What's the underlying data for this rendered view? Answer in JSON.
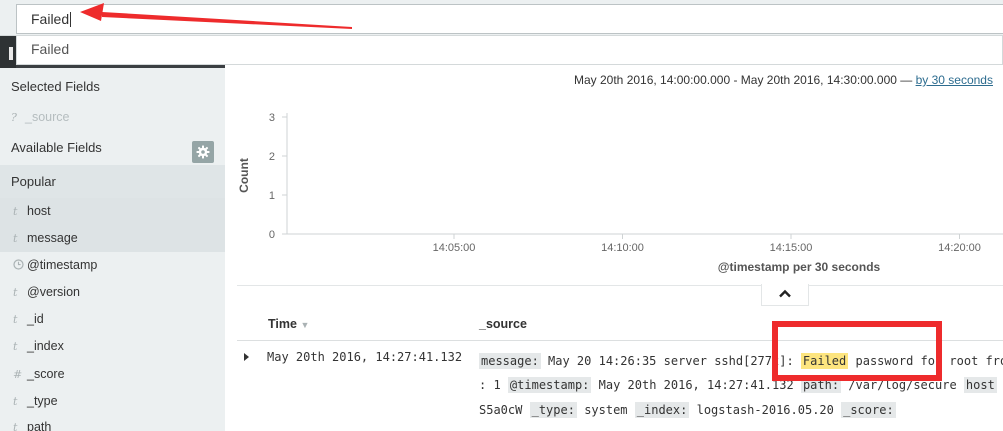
{
  "search": {
    "query": "Failed",
    "suggestion": "Failed"
  },
  "sidebar": {
    "selected_fields_label": "Selected Fields",
    "selected_fields": [
      {
        "type": "?",
        "name": "_source"
      }
    ],
    "available_fields_label": "Available Fields",
    "popular_label": "Popular",
    "fields": [
      {
        "type": "t",
        "name": "host"
      },
      {
        "type": "t",
        "name": "message"
      },
      {
        "type": "clock",
        "name": "@timestamp"
      },
      {
        "type": "t",
        "name": "@version"
      },
      {
        "type": "t",
        "name": "_id"
      },
      {
        "type": "t",
        "name": "_index"
      },
      {
        "type": "#",
        "name": "_score"
      },
      {
        "type": "t",
        "name": "_type"
      },
      {
        "type": "t",
        "name": "path"
      }
    ]
  },
  "header": {
    "time_range": "May 20th 2016, 14:00:00.000 - May 20th 2016, 14:30:00.000 —",
    "interval_link": "by 30 seconds"
  },
  "chart_data": {
    "type": "bar",
    "ylabel": "Count",
    "xlabel": "@timestamp per 30 seconds",
    "yticks": [
      "3",
      "2",
      "1",
      "0"
    ],
    "xticks": [
      "14:05:00",
      "14:10:00",
      "14:15:00",
      "14:20:00"
    ],
    "ylim": [
      0,
      3
    ],
    "values": [],
    "grid": true
  },
  "table": {
    "columns": {
      "time": "Time",
      "source": "_source"
    },
    "rows": [
      {
        "time": "May 20th 2016, 14:27:41.132",
        "line1": {
          "k_message": "message:",
          "msg_before": "May 20 14:26:35 server sshd[2772]:",
          "highlight": "Failed",
          "msg_after": "password for root fro"
        },
        "line2": {
          "pre": ": 1",
          "k_timestamp": "@timestamp:",
          "timestamp": "May 20th 2016, 14:27:41.132",
          "k_path": "path:",
          "path": "/var/log/secure",
          "k_host": "host"
        },
        "line3": {
          "id": "S5a0cW",
          "k_type": "_type:",
          "type": "system",
          "k_index": "_index:",
          "index": "logstash-2016.05.20",
          "k_score": "_score:"
        }
      }
    ]
  },
  "colors": {
    "accent": "#2d6c8f",
    "sidebar_bg": "#ecf0f1",
    "highlight": "#fde57f",
    "annotation": "#ee2b2c"
  }
}
